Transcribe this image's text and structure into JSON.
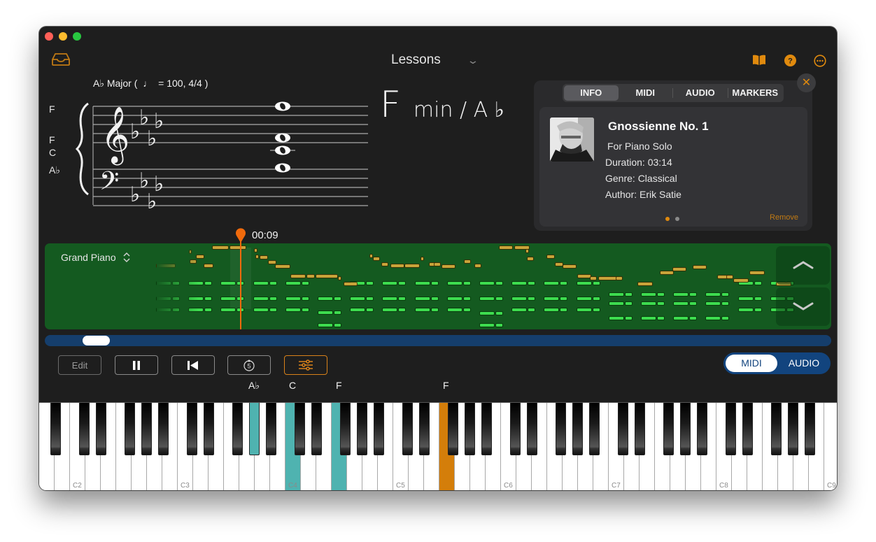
{
  "window": {
    "title_selector": "Lessons",
    "icons": [
      "inbox-icon",
      "book-icon",
      "help-icon",
      "more-icon"
    ]
  },
  "score": {
    "key_signature": "A♭ Major (",
    "tempo_glyph": "♩",
    "tempo": "= 100, 4/4 )",
    "note_labels": [
      "F",
      "F",
      "C",
      "A♭"
    ]
  },
  "chord": {
    "root": "F",
    "quality": "min / A ♭"
  },
  "info_panel": {
    "tabs": [
      {
        "label": "INFO",
        "active": true
      },
      {
        "label": "MIDI",
        "active": false
      },
      {
        "label": "AUDIO",
        "active": false
      },
      {
        "label": "MARKERS",
        "active": false
      }
    ],
    "song_title": "Gnossienne No. 1",
    "subtitle": "For Piano Solo",
    "duration": "Duration: 03:14",
    "genre": "Genre:  Classical",
    "author": "Author:  Erik Satie",
    "page_dots": {
      "count": 2,
      "active": 0
    },
    "remove_label": "Remove",
    "accent_color": "#e08a0e"
  },
  "timeline": {
    "current_time": "00:09",
    "instrument": "Grand Piano",
    "scroll_position": 0.05
  },
  "transport": {
    "edit_label": "Edit",
    "buttons": [
      "pause-icon",
      "skip-back-icon",
      "replay-5-icon",
      "mixer-icon"
    ]
  },
  "mode_toggle": {
    "options": [
      "MIDI",
      "AUDIO"
    ],
    "selected": "MIDI"
  },
  "keyboard": {
    "highlight_labels": [
      {
        "text": "A♭",
        "note": "Ab3"
      },
      {
        "text": "C",
        "note": "C4"
      },
      {
        "text": "F",
        "note": "F4"
      },
      {
        "text": "F",
        "note": "F5"
      }
    ],
    "octave_labels": [
      "C2",
      "C3",
      "C4",
      "C5",
      "C6",
      "C7",
      "C8",
      "C9"
    ],
    "teal_keys": [
      "Ab3",
      "C4",
      "F4"
    ],
    "orange_keys": [
      "F5"
    ],
    "colors": {
      "teal": "#4fb3b0",
      "orange": "#d47e0a"
    }
  }
}
